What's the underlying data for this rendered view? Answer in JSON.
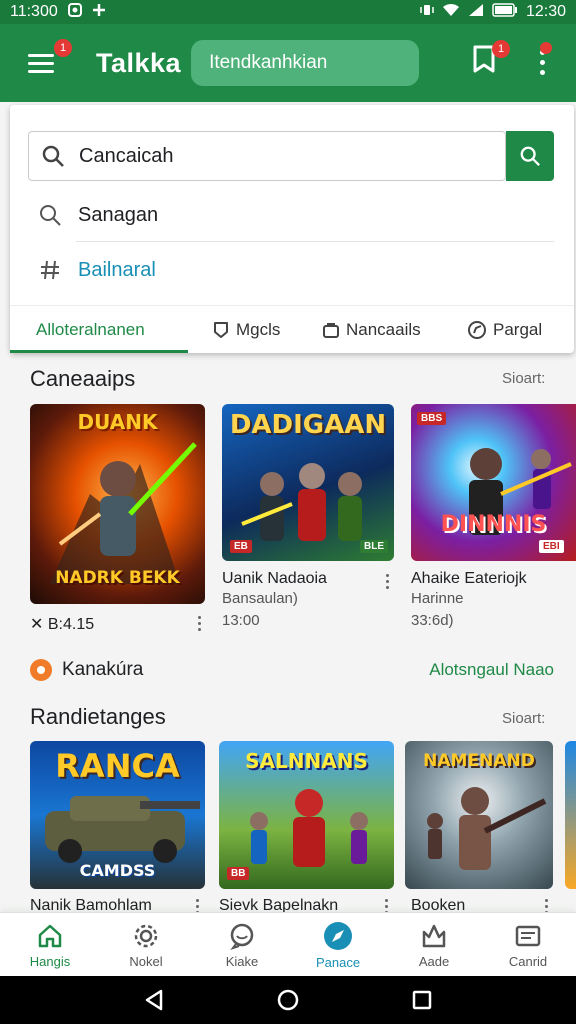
{
  "status_bar": {
    "time_left": "11:300",
    "time_right": "12:30"
  },
  "app_bar": {
    "title": "Talkka",
    "search_placeholder": "Itendkanhkian",
    "menu_badge": "1",
    "bookmark_badge": "1"
  },
  "search": {
    "query": "Cancaicah",
    "suggestions": [
      {
        "icon": "search-icon",
        "label": "Sanagan"
      },
      {
        "icon": "hashtag-icon",
        "label": "Bailnaral"
      }
    ]
  },
  "tabs": [
    {
      "icon": "",
      "label": "Alloteralnanen",
      "active": true
    },
    {
      "icon": "shield-icon",
      "label": "Mgcls",
      "active": false
    },
    {
      "icon": "bag-icon",
      "label": "Nancaails",
      "active": false
    },
    {
      "icon": "compass-icon",
      "label": "Pargal",
      "active": false
    }
  ],
  "section1": {
    "title": "Caneaaips",
    "see_all": "Sioart:",
    "cards": [
      {
        "art_title": "NADRK BEKK",
        "art_top": "DUANK",
        "meta": "✕ B:4.15",
        "name": "",
        "sub": "",
        "price": ""
      },
      {
        "art_title": "DADIGAAN",
        "art_top": "",
        "tag": "EB",
        "tag2": "BLE",
        "name": "Uanik Nadaoia",
        "sub": "Bansaulan)",
        "price": "13:00"
      },
      {
        "art_title": "DINNNIS",
        "art_top": "",
        "tag": "BBS",
        "tag2": "EBI",
        "name": "Ahaike Eateriojk",
        "sub": "Harinne",
        "price": "33:6d)"
      }
    ]
  },
  "promo": {
    "label": "Kanakúra",
    "link": "Alotsngaul Naao"
  },
  "section2": {
    "title": "Randietanges",
    "see_all": "Sioart:",
    "cards": [
      {
        "art_title": "RANCA",
        "art_bottom": "CAMDSS",
        "name": "Nanik Bamohlam"
      },
      {
        "art_title": "SALNNANS",
        "tag": "BB",
        "name": "Sievk Bapelnakn"
      },
      {
        "art_title": "NAMENAND",
        "tag": "",
        "name": "Booken"
      }
    ]
  },
  "bottom_nav": [
    {
      "icon": "home-icon",
      "label": "Hangis",
      "state": "active"
    },
    {
      "icon": "gear-icon",
      "label": "Nokel",
      "state": ""
    },
    {
      "icon": "chat-icon",
      "label": "Kiake",
      "state": ""
    },
    {
      "icon": "rocket-icon",
      "label": "Panace",
      "state": "highlight"
    },
    {
      "icon": "trophy-icon",
      "label": "Aade",
      "state": ""
    },
    {
      "icon": "mail-icon",
      "label": "Canrid",
      "state": ""
    }
  ],
  "colors": {
    "brand_green": "#1f8a47",
    "status_green": "#197a3c",
    "highlight_blue": "#1a8fb5",
    "badge_red": "#e53935"
  }
}
